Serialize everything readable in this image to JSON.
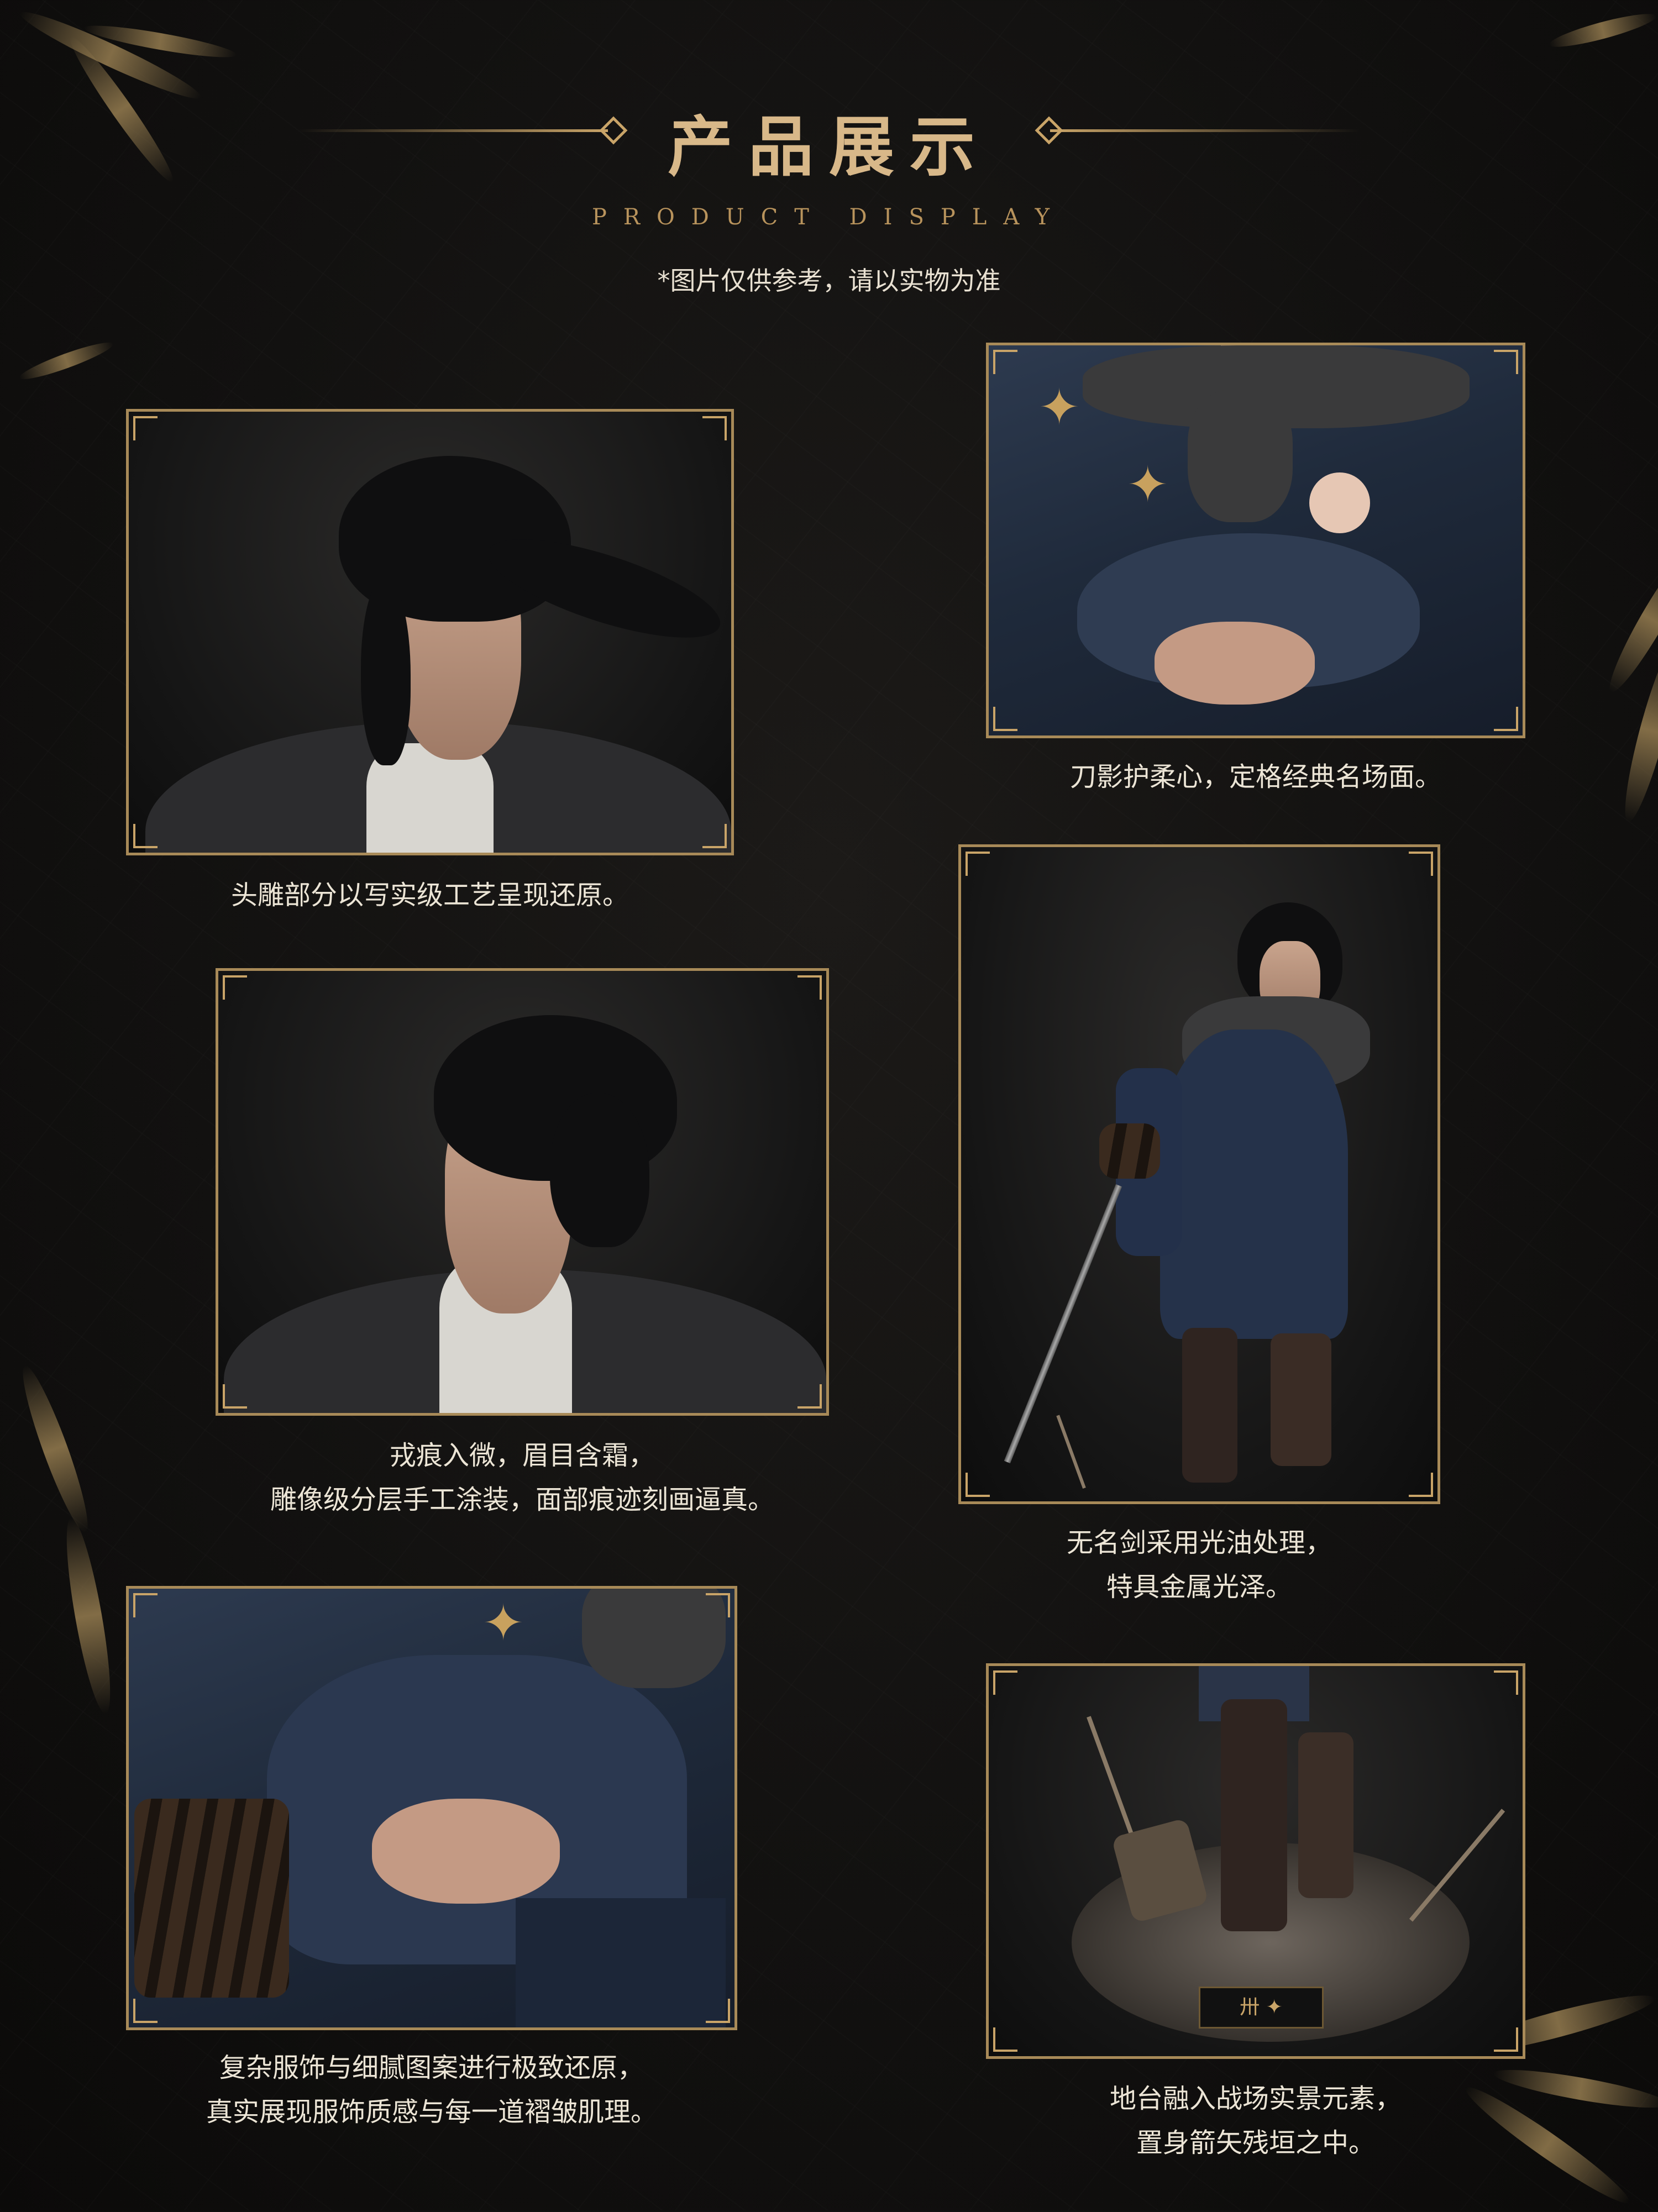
{
  "header": {
    "title": "产品展示",
    "subtitle": "PRODUCT DISPLAY",
    "note": "*图片仅供参考，请以实物为准"
  },
  "panels": [
    {
      "caption_lines": [
        "头雕部分以写实级工艺呈现还原。"
      ]
    },
    {
      "caption_lines": [
        "刀影护柔心，定格经典名场面。"
      ]
    },
    {
      "caption_lines": [
        "戎痕入微，眉目含霜，",
        "雕像级分层手工涂装，面部痕迹刻画逼真。"
      ]
    },
    {
      "caption_lines": [
        "无名剑采用光油处理，",
        "特具金属光泽。"
      ]
    },
    {
      "caption_lines": [
        "复杂服饰与细腻图案进行极致还原，",
        "真实展现服饰质感与每一道褶皱肌理。"
      ]
    },
    {
      "caption_lines": [
        "地台融入战场实景元素，",
        "置身箭矢残垣之中。"
      ]
    }
  ],
  "colors": {
    "accent_gold": "#c9a468",
    "background": "#121110",
    "text": "#ece5d6"
  }
}
